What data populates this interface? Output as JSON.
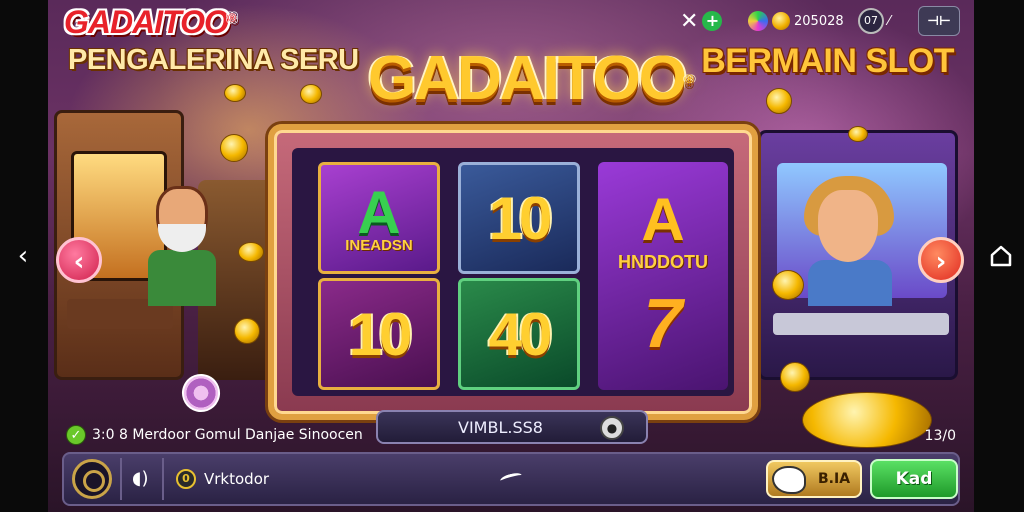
{
  "system": {
    "back_glyph": "‹",
    "back_icon": "back-chevron-icon",
    "home_icon": "home-icon"
  },
  "header": {
    "logo": "GADAITOO",
    "logo_mark": "®",
    "subtitle_left": "PENGALERINA SERU",
    "title": "GADAITOO",
    "title_mark": "®",
    "subtitle_right": "BERMAIN SLOT"
  },
  "hud": {
    "gift_glyph": "✕",
    "add_glyph": "+",
    "coins_value": "205028",
    "level_value": "07",
    "level_arrow": "⁄",
    "menu_glyph": "⊣⊢"
  },
  "nav": {
    "prev_glyph": "‹",
    "next_glyph": "›"
  },
  "reels": [
    {
      "symbol": "A",
      "label": "INEADSN"
    },
    {
      "symbol": "10"
    },
    {
      "symbol": "10"
    },
    {
      "symbol": "40"
    },
    {
      "symbol": "A",
      "label": "HNDDOTU",
      "symbol2": "7"
    }
  ],
  "spin_bar": {
    "text": "VIMBL.SS8",
    "button_glyph": "●"
  },
  "info": {
    "check_glyph": "✓",
    "text": "3:0 8 Merdoor Gomul Danjae Sinoocen",
    "right": "13/0"
  },
  "toolbar": {
    "sound_glyph": "◖)",
    "player_glyph": "0",
    "player_name": "Vrktodor",
    "bet_label": "B.IA",
    "play_label": "Kad"
  },
  "colors": {
    "accent_gold": "#ffc92e",
    "play_green": "#1f9a2a",
    "logo_red": "#e8222a"
  }
}
